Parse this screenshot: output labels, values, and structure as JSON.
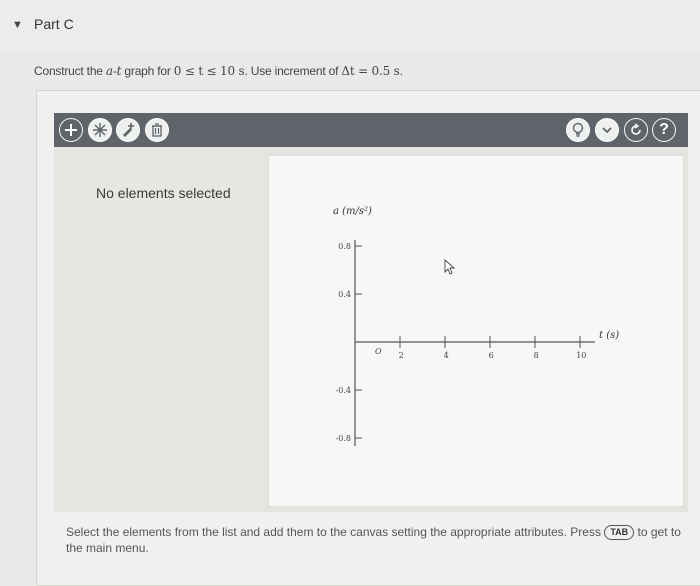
{
  "part": {
    "caret": "▼",
    "title": "Part C"
  },
  "prompt": {
    "pre": "Construct the ",
    "var_a": "a",
    "dash": "-",
    "var_t": "t",
    "mid": " graph for ",
    "range": "0 ≤ t ≤ 10 s",
    "post": ". Use increment of ",
    "increment": "Δt = 0.5 s",
    "end": "."
  },
  "toolbar": {
    "left_buttons": [
      "add-icon",
      "asterisk-icon",
      "edit-add-icon",
      "trash-icon"
    ],
    "right_buttons": [
      "lightbulb-icon",
      "chevron-down-icon",
      "reset-icon",
      "help-icon"
    ],
    "help_label": "?"
  },
  "left_panel": {
    "status": "No elements selected"
  },
  "chart_data": {
    "type": "line",
    "ylabel": "a (m/s²)",
    "xlabel": "t (s)",
    "origin_label": "O",
    "xlim": [
      0,
      10
    ],
    "ylim": [
      -0.8,
      0.8
    ],
    "x_ticks": [
      2,
      4,
      6,
      8,
      10
    ],
    "y_ticks": [
      0.8,
      0.4,
      -0.4,
      -0.8
    ],
    "x_tick_labels": [
      "2",
      "4",
      "6",
      "8",
      "10"
    ],
    "y_tick_labels": [
      "0.8",
      "0.4",
      "-0.4",
      "-0.8"
    ],
    "series": []
  },
  "footer": {
    "line1": "Select the elements from the list and add them to the canvas setting the appropriate attributes. Press",
    "key": "TAB",
    "line2": "to get to the main menu."
  },
  "colors": {
    "toolbar": "#5f636a",
    "background": "#e9e9e7",
    "canvas": "#f7f7f5"
  }
}
